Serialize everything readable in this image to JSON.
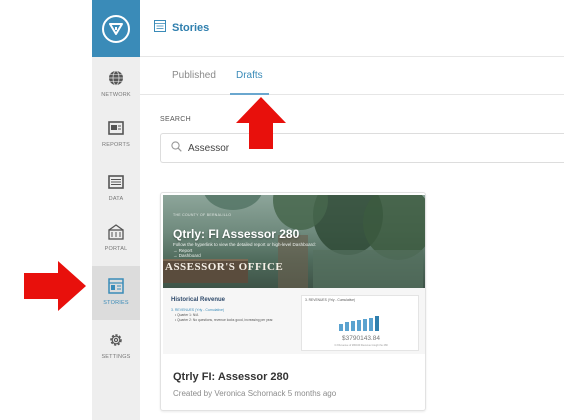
{
  "sidebar": {
    "items": [
      {
        "label": "NETWORK",
        "icon": "globe-icon"
      },
      {
        "label": "REPORTS",
        "icon": "reports-icon"
      },
      {
        "label": "DATA",
        "icon": "data-icon"
      },
      {
        "label": "PORTAL",
        "icon": "portal-icon"
      },
      {
        "label": "STORIES",
        "icon": "stories-icon",
        "active": true
      },
      {
        "label": "SETTINGS",
        "icon": "gear-icon"
      }
    ]
  },
  "header": {
    "title": "Stories",
    "icon": "stories-page-icon"
  },
  "tabs": [
    {
      "label": "Published",
      "active": false
    },
    {
      "label": "Drafts",
      "active": true
    }
  ],
  "search": {
    "label": "SEARCH",
    "value": "Assessor",
    "icon": "search-icon"
  },
  "card": {
    "title": "Qtrly FI: Assessor 280",
    "meta": "Created by Veronica Schornack 5 months ago",
    "thumbnail": {
      "small_text": "THE COUNTY OF BERNALILLO",
      "title": "Qtrly: FI Assessor 280",
      "subtitle": "Follow the hyperlink to view the detailed report or high-level Dashboard:",
      "links": [
        "→ Report",
        "→ Dashboard"
      ],
      "sign_text": "ASSESSOR'S OFFICE",
      "history_title": "Historical Revenue",
      "history_subtitle": "3. REVENUES (Yrly - Cumulative)",
      "history_bullets": [
        "• Quarter 1: N/A",
        "• Quarter 2: No questions, revenue looks good, increasing per year."
      ],
      "mini_chart_title": "3. REVENUES (Yrly - Cumulative)",
      "mini_chart_value": "$3790143.84",
      "mini_chart_foot": "3.3 Revenue of 280040 Revenue trough the 280"
    }
  },
  "colors": {
    "accent": "#3a8bb8",
    "arrow": "#e8100c"
  }
}
